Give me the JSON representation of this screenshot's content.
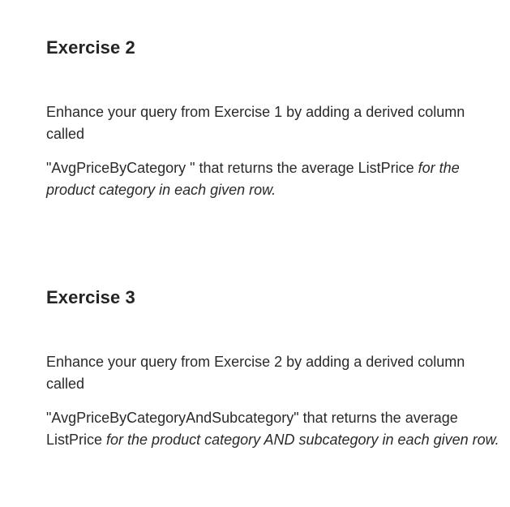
{
  "exercises": [
    {
      "title": "Exercise 2",
      "intro": "Enhance your query from Exercise 1 by adding a derived column called",
      "detail_plain": "\"AvgPriceByCategory \" that returns the average ListPrice ",
      "detail_italic": "for the product category in each given row."
    },
    {
      "title": "Exercise 3",
      "intro": "Enhance your query from Exercise 2 by adding a derived column called",
      "detail_plain": "\"AvgPriceByCategoryAndSubcategory\" that returns the average ListPrice ",
      "detail_italic": "for the product category AND subcategory in each given row."
    }
  ]
}
